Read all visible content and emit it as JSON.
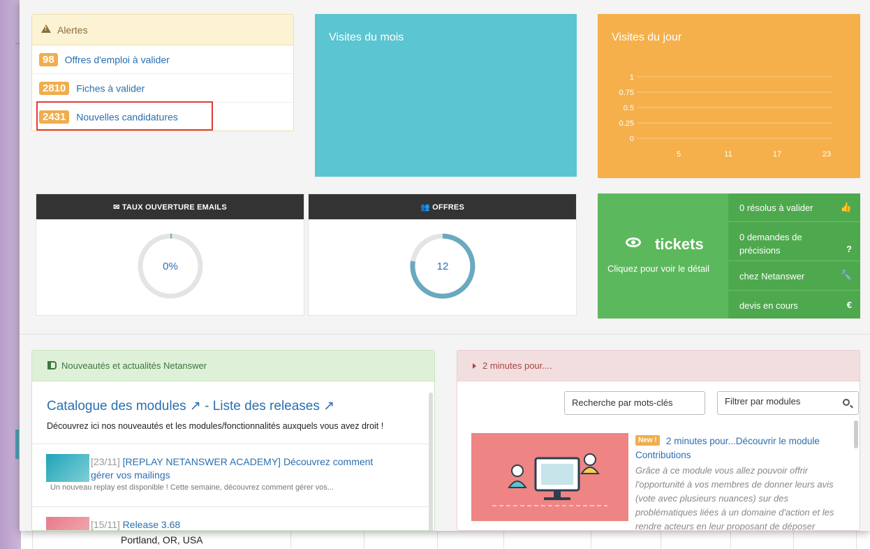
{
  "background": {
    "location_text": "Portland, OR, USA"
  },
  "alerts": {
    "title": "Alertes",
    "items": [
      {
        "count": "98",
        "label": "Offres d'emploi à valider"
      },
      {
        "count": "2810",
        "label": "Fiches à valider"
      },
      {
        "count": "2431",
        "label": "Nouvelles candidatures"
      }
    ]
  },
  "visites_mois": {
    "title": "Visites du mois"
  },
  "visites_jour": {
    "title": "Visites du jour",
    "y_ticks": [
      "1",
      "0.75",
      "0.5",
      "0.25",
      "0"
    ],
    "x_ticks": [
      "5",
      "11",
      "17",
      "23"
    ]
  },
  "emails": {
    "title": "TAUX OUVERTURE EMAILS",
    "value": "0%"
  },
  "offres": {
    "title": "OFFRES",
    "value": "12"
  },
  "tickets": {
    "title": "tickets",
    "subtitle": "Cliquez pour voir le détail",
    "rows": [
      {
        "label": "0 résolus à valider",
        "icon": "thumbs-up-icon"
      },
      {
        "label": "0 demandes de précisions",
        "icon": "question-icon"
      },
      {
        "label": "chez Netanswer",
        "icon": "wrench-icon"
      },
      {
        "label": "devis en cours",
        "icon": "euro-icon"
      }
    ]
  },
  "news": {
    "title": "Nouveautés et actualités Netanswer",
    "catalog_link": "Catalogue des modules",
    "separator": " - ",
    "releases_link": "Liste des releases",
    "description": "Découvrez ici nos nouveautés et les modules/fonctionnalités auxquels vous avez droit !",
    "items": [
      {
        "date": "[23/11]",
        "title": "[REPLAY NETANSWER ACADEMY] Découvrez comment gérer vos mailings",
        "excerpt": "Un nouveau replay est disponible ! Cette semaine, découvrez comment gérer vos..."
      },
      {
        "date": "[15/11]",
        "title": "Release 3.68",
        "excerpt": ""
      }
    ]
  },
  "two_minutes": {
    "title": "2 minutes pour....",
    "search_placeholder": "Recherche par mots-clés",
    "filter_label": "Filtrer par modules",
    "item": {
      "badge": "New !",
      "title": "2 minutes pour...Découvrir le module Contributions",
      "text": "Grâce à ce module vous allez pouvoir offrir l'opportunité à vos membres de donner leurs avis (vote avec plusieurs nuances) sur des problématiques liées à un domaine d'action et les rendre acteurs en leur proposant de déposer"
    }
  },
  "colors": {
    "alert_badge": "#f0ad4e",
    "visites_mois": "#5bc5d1",
    "visites_jour": "#f5b04c",
    "tickets": "#5cb85c",
    "gauge": "#6aa9bf"
  }
}
